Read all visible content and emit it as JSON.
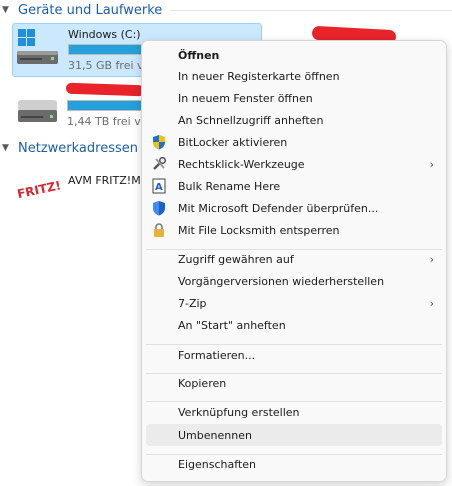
{
  "sections": {
    "drives_header": "Geräte und Laufwerke",
    "network_header": "Netzwerkadressen"
  },
  "drives": [
    {
      "name": "Windows (C:)",
      "free": "31,5 GB frei vo",
      "used_fraction": 0.87,
      "selected": true
    },
    {
      "name": "",
      "free": "1,44 TB frei vo",
      "used_fraction": 0.82,
      "selected": false
    }
  ],
  "network": {
    "item_label": "AVM FRITZ!M",
    "logo_text": "FRITZ!"
  },
  "menu": {
    "items": [
      {
        "label": "Öffnen",
        "icon": "",
        "submenu": false,
        "bold": true
      },
      {
        "label": "In neuer Registerkarte öffnen",
        "icon": "",
        "submenu": false
      },
      {
        "label": "In neuem Fenster öffnen",
        "icon": "",
        "submenu": false
      },
      {
        "label": "An Schnellzugriff anheften",
        "icon": "",
        "submenu": false
      },
      {
        "label": "BitLocker aktivieren",
        "icon": "shield-uac-icon",
        "submenu": false
      },
      {
        "label": "Rechtsklick-Werkzeuge",
        "icon": "tools-icon",
        "submenu": true
      },
      {
        "label": "Bulk Rename Here",
        "icon": "bulk-rename-icon",
        "submenu": false
      },
      {
        "label": "Mit Microsoft Defender überprüfen...",
        "icon": "defender-icon",
        "submenu": false
      },
      {
        "label": "Mit File Locksmith entsperren",
        "icon": "lock-icon",
        "submenu": false
      },
      {
        "label": "Zugriff gewähren auf",
        "icon": "",
        "submenu": true
      },
      {
        "label": "Vorgängerversionen wiederherstellen",
        "icon": "",
        "submenu": false
      },
      {
        "label": "7-Zip",
        "icon": "",
        "submenu": true
      },
      {
        "label": "An \"Start\" anheften",
        "icon": "",
        "submenu": false
      },
      {
        "label": "Formatieren...",
        "icon": "",
        "submenu": false
      },
      {
        "label": "Kopieren",
        "icon": "",
        "submenu": false
      },
      {
        "label": "Verknüpfung erstellen",
        "icon": "",
        "submenu": false
      },
      {
        "label": "Umbenennen",
        "icon": "",
        "submenu": false,
        "highlighted": true
      },
      {
        "label": "Eigenschaften",
        "icon": "",
        "submenu": false
      }
    ]
  },
  "colors": {
    "accent": "#1a5ea8",
    "selection": "#cce8ff",
    "bar_fill": "#26a0da",
    "redaction": "#e8242a"
  }
}
